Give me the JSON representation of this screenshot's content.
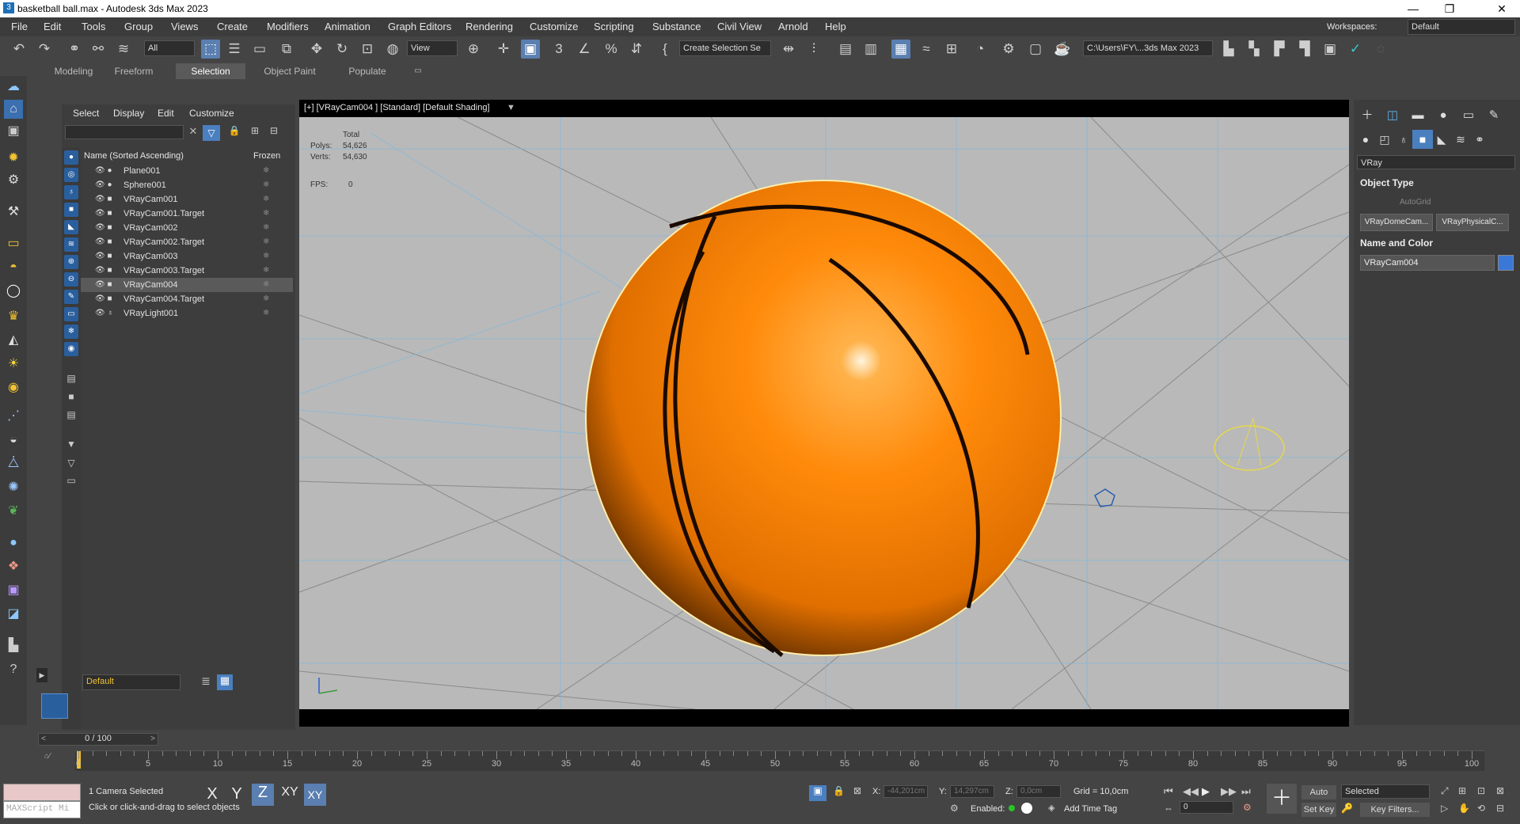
{
  "window": {
    "title": "basketball ball.max - Autodesk 3ds Max 2023",
    "minimize": "—",
    "maximize": "❐",
    "close": "✕"
  },
  "menubar": [
    "File",
    "Edit",
    "Tools",
    "Group",
    "Views",
    "Create",
    "Modifiers",
    "Animation",
    "Graph Editors",
    "Rendering",
    "Customize",
    "Scripting",
    "Substance",
    "Civil View",
    "Arnold",
    "Help"
  ],
  "workspaces": {
    "label": "Workspaces:",
    "value": "Default"
  },
  "toolbar": {
    "selection_filter": "All",
    "ref_coord": "View",
    "named_selection": "Create Selection Se",
    "path": "C:\\Users\\FY\\...3ds Max 2023"
  },
  "ribbon_tabs": [
    "Modeling",
    "Freeform",
    "Selection",
    "Object Paint",
    "Populate"
  ],
  "scene_explorer": {
    "menu": [
      "Select",
      "Display",
      "Edit",
      "Customize"
    ],
    "col_name": "Name (Sorted Ascending)",
    "col_frozen": "Frozen",
    "items": [
      "Plane001",
      "Sphere001",
      "VRayCam001",
      "VRayCam001.Target",
      "VRayCam002",
      "VRayCam002.Target",
      "VRayCam003",
      "VRayCam003.Target",
      "VRayCam004",
      "VRayCam004.Target",
      "VRayLight001"
    ],
    "selected": "VRayCam004",
    "layer": "Default"
  },
  "viewport": {
    "label": "[+] [VRayCam004 ] [Standard] [Default Shading]",
    "stats_header": "Total",
    "polys_label": "Polys:",
    "polys": "54,626",
    "verts_label": "Verts:",
    "verts": "54,630",
    "fps_label": "FPS:",
    "fps": "0"
  },
  "command_panel": {
    "category": "VRay",
    "object_type_title": "Object Type",
    "autogrid": "AutoGrid",
    "buttons": [
      "VRayDomeCam...",
      "VRayPhysicalC..."
    ],
    "name_color_title": "Name and Color",
    "object_name": "VRayCam004",
    "object_color": "#3a78d8"
  },
  "timeline": {
    "frame": "0 / 100",
    "ticks": [
      "0",
      "5",
      "10",
      "15",
      "20",
      "25",
      "30",
      "35",
      "40",
      "45",
      "50",
      "55",
      "60",
      "65",
      "70",
      "75",
      "80",
      "85",
      "90",
      "95",
      "100"
    ]
  },
  "status": {
    "maxscript": "MAXScript Mi",
    "selected": "1 Camera Selected",
    "prompt": "Click or click-and-drag to select objects",
    "axes": [
      "X",
      "Y",
      "Z",
      "XY",
      "XY"
    ],
    "x_label": "X:",
    "x_val": "-44,201cm",
    "y_label": "Y:",
    "y_val": "14,297cm",
    "z_label": "Z:",
    "z_val": "0,0cm",
    "grid": "Grid = 10,0cm",
    "enabled": "Enabled:",
    "add_time_tag": "Add Time Tag",
    "auto_key": "Auto Key",
    "set_key": "Set Key",
    "key_mode": "Selected",
    "key_filters": "Key Filters...",
    "frame_value": "0"
  }
}
